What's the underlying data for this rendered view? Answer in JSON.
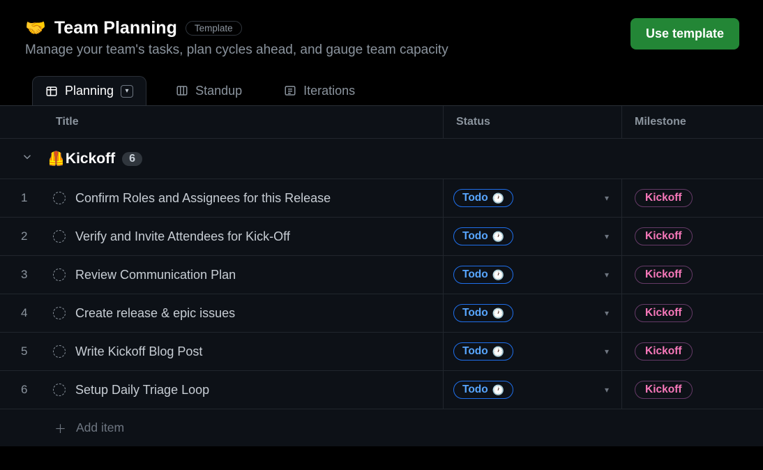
{
  "header": {
    "emoji": "🤝",
    "title": "Team Planning",
    "template_badge": "Template",
    "subtitle": "Manage your team's tasks, plan cycles ahead, and gauge team capacity",
    "use_button": "Use template"
  },
  "tabs": [
    {
      "label": "Planning",
      "active": true,
      "icon": "table"
    },
    {
      "label": "Standup",
      "active": false,
      "icon": "board"
    },
    {
      "label": "Iterations",
      "active": false,
      "icon": "list"
    }
  ],
  "columns": {
    "title": "Title",
    "status": "Status",
    "milestone": "Milestone"
  },
  "group": {
    "emoji": "🦺",
    "name": "Kickoff",
    "count": "6"
  },
  "status_label": "Todo",
  "milestone_label": "Kickoff",
  "items": [
    {
      "num": "1",
      "title": "Confirm Roles and Assignees for this Release"
    },
    {
      "num": "2",
      "title": "Verify and Invite Attendees for Kick-Off"
    },
    {
      "num": "3",
      "title": "Review Communication Plan"
    },
    {
      "num": "4",
      "title": "Create release & epic issues"
    },
    {
      "num": "5",
      "title": "Write Kickoff Blog Post"
    },
    {
      "num": "6",
      "title": "Setup Daily Triage Loop"
    }
  ],
  "add_item": "Add item"
}
